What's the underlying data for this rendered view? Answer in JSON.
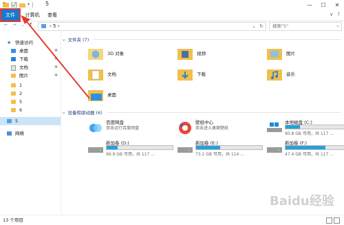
{
  "window": {
    "title": "5"
  },
  "ribbon": {
    "tabs": [
      "文件",
      "计算机",
      "查看"
    ],
    "expand": "∨",
    "help": "?"
  },
  "address": {
    "path": "5",
    "search_placeholder": "搜索\"5\""
  },
  "nav": {
    "quick_access": "快速访问",
    "items": [
      {
        "label": "快速访问",
        "pinned": false
      },
      {
        "label": "桌面",
        "pinned": true
      },
      {
        "label": "下载",
        "pinned": true
      },
      {
        "label": "文档",
        "pinned": true
      },
      {
        "label": "图片",
        "pinned": true
      },
      {
        "label": "1",
        "pinned": false
      },
      {
        "label": "2",
        "pinned": false
      },
      {
        "label": "5",
        "pinned": false
      },
      {
        "label": "6",
        "pinned": false
      },
      {
        "label": "5",
        "pinned": false,
        "selected": true
      },
      {
        "label": "网络",
        "pinned": false
      }
    ]
  },
  "folders": {
    "header": "文件夹 (7)",
    "items": [
      {
        "name": "3D 对象"
      },
      {
        "name": "视频"
      },
      {
        "name": "图片"
      },
      {
        "name": "文档"
      },
      {
        "name": "下载"
      },
      {
        "name": "音乐"
      },
      {
        "name": "桌面"
      }
    ]
  },
  "devices": {
    "header": "设备和驱动器 (6)",
    "items": [
      {
        "name": "百度网盘",
        "sub": "双击运行百度网盘"
      },
      {
        "name": "壁纸中心",
        "sub": "双击进入桌面壁纸"
      },
      {
        "name": "本地磁盘 (C:)",
        "size": "90.8 GB 可用，共 117 ...",
        "used": 0.22
      },
      {
        "name": "新加卷 (D:)",
        "size": "96.9 GB 可用，共 117 ...",
        "used": 0.17
      },
      {
        "name": "新加卷 (E:)",
        "size": "73.1 GB 可用，共 114 ...",
        "used": 0.36
      },
      {
        "name": "新加卷 (F:)",
        "size": "47.4 GB 可用，共 117 ...",
        "used": 0.6
      }
    ]
  },
  "status": {
    "count": "13 个项目"
  },
  "watermark": "Baidu经验",
  "colors": {
    "accent": "#1979ca",
    "highlight": "#e53935",
    "drive_bar": "#26a0da"
  }
}
